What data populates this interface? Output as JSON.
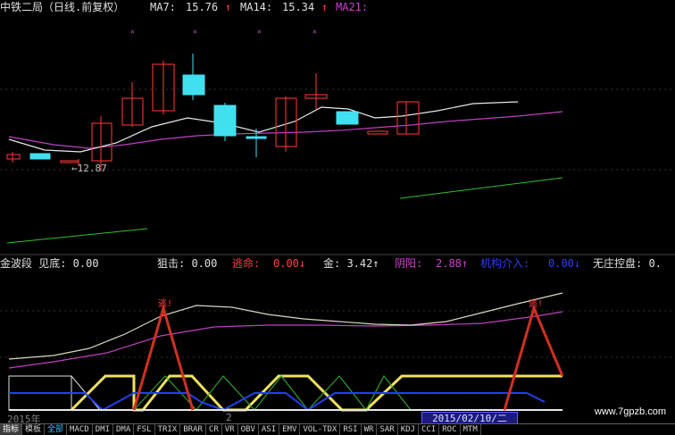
{
  "header": {
    "title": "中铁二局（日线.前复权）",
    "ma7_label": "MA7:",
    "ma7_value": "15.76",
    "ma14_label": "MA14:",
    "ma14_value": "15.34",
    "ma21_label": "MA21:",
    "up_arrow": "↑"
  },
  "price_panel": {
    "low_marker": "←12.87"
  },
  "indicator_bar": {
    "item1": "金波段 见底: 0.00",
    "item2": "狙击: 0.00",
    "item3_label": "逃命:",
    "item3_value": "0.00↓",
    "item4": "金: 3.42↑",
    "item5_label": "阴阳:",
    "item5_value": "2.88↑",
    "item6_label": "机构介入:",
    "item6_value": "0.00↓",
    "item7": "无庄控盘: 0."
  },
  "indicator_panel": {
    "escape_mark": "逃!"
  },
  "bottom": {
    "year": "2015年",
    "marker": "2",
    "date": "2015/02/10/二",
    "watermark": "www.7gpzb.com"
  },
  "tabs": [
    "指标",
    "模板",
    "全部",
    "MACD",
    "DMI",
    "DMA",
    "FSL",
    "TRIX",
    "BRAR",
    "CR",
    "VR",
    "OBV",
    "ASI",
    "EMV",
    "VOL-TDX",
    "RSI",
    "WR",
    "SAR",
    "KDJ",
    "CCI",
    "ROC",
    "MTM"
  ],
  "colors": {
    "up": "#e03030",
    "down": "#40e0f0",
    "ma_white": "#e8e8e8",
    "ma_purple": "#c040c0",
    "green_line": "#30c030",
    "yellow": "#f0e060",
    "blue": "#2040f0",
    "red_ind": "#d03020"
  }
}
